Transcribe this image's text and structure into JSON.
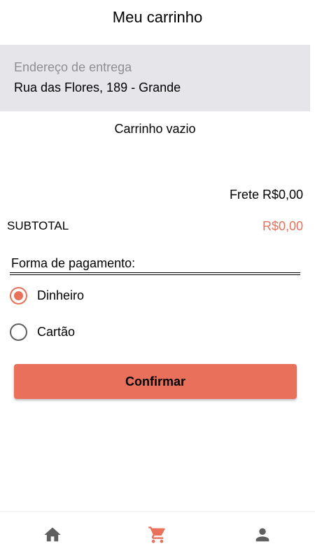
{
  "header": {
    "title": "Meu carrinho"
  },
  "address": {
    "label": "Endereço de entrega",
    "value": "Rua das Flores, 189 - Grande"
  },
  "cart": {
    "empty_text": "Carrinho vazio"
  },
  "summary": {
    "shipping": "Frete R$0,00",
    "subtotal_label": "SUBTOTAL",
    "subtotal_value": "R$0,00"
  },
  "payment": {
    "title": "Forma de pagamento:",
    "options": [
      {
        "label": "Dinheiro",
        "selected": true
      },
      {
        "label": "Cartão",
        "selected": false
      }
    ]
  },
  "actions": {
    "confirm_label": "Confirmar"
  },
  "nav": {
    "items": [
      {
        "icon": "home-icon",
        "active": false
      },
      {
        "icon": "cart-icon",
        "active": true
      },
      {
        "icon": "profile-icon",
        "active": false
      }
    ]
  },
  "colors": {
    "accent": "#e9705a",
    "address_bg": "#e5e5ea",
    "muted_text": "#8e8e93",
    "inactive_icon": "#5f5f5f"
  }
}
